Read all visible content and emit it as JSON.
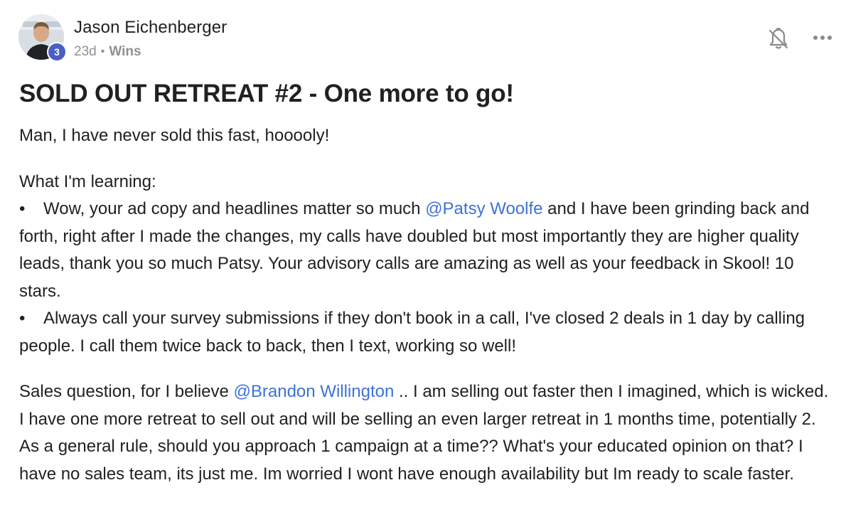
{
  "author": {
    "name": "Jason Eichenberger",
    "level": "3"
  },
  "meta": {
    "time": "23d",
    "separator": "•",
    "category": "Wins"
  },
  "actions": {
    "more_label": "•••"
  },
  "post": {
    "title": "SOLD OUT RETREAT #2 - One more to go!",
    "intro": "Man, I have never sold this fast, hooooly!",
    "learning_heading": "What I'm learning:",
    "bullet_glyph": "•",
    "bullet1_pre": "Wow, your ad copy and headlines matter so much ",
    "bullet1_mention": "@Patsy Woolfe",
    "bullet1_post": " and I have been grinding back and forth, right after I made the changes, my calls have doubled but most importantly they are higher quality leads, thank you so much Patsy. Your advisory calls are amazing as well as your feedback in Skool! 10 stars.",
    "bullet2": "Always call your survey submissions if they don't book in a call, I've closed 2 deals in 1 day by calling people. I call them twice back to back, then I text, working so well!",
    "question_pre": "Sales question, for I believe ",
    "question_mention": "@Brandon Willington",
    "question_post": " .. I am selling out faster then I imagined, which is wicked. I have one more retreat to sell out and will be selling an even larger retreat in 1 months time, potentially 2. As a general rule, should you approach 1 campaign at a time?? What's your educated opinion on that? I have no sales team, its just me. Im worried I wont have enough availability but Im ready to scale faster."
  },
  "colors": {
    "mention": "#3e72d8",
    "badge": "#4a5ec4",
    "meta_text": "#909090"
  },
  "icons": {
    "bell": "bell-off-icon",
    "more": "more-horizontal-icon"
  }
}
